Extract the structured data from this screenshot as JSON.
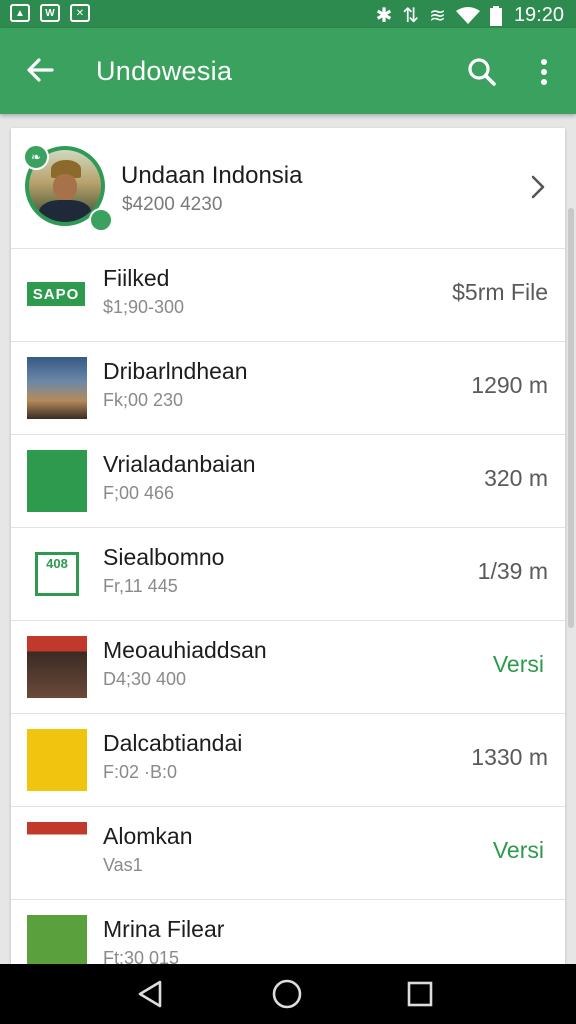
{
  "status_bar": {
    "time": "19:20",
    "left_icons": [
      "image-icon",
      "photo-icon",
      "no-signal-icon"
    ],
    "right_icons": [
      "bluetooth-icon",
      "network-icon",
      "vibrate-icon",
      "wifi-icon",
      "battery-icon"
    ]
  },
  "app_bar": {
    "title": "Undowesia",
    "back_icon": "arrow-left-icon",
    "search_icon": "search-icon",
    "more_icon": "more-vert-icon"
  },
  "profile": {
    "name": "Undaan Indonsia",
    "subtitle": "$4200 4230"
  },
  "rows": [
    {
      "title": "Fiilked",
      "subtitle": "$1;90-300",
      "value": "$5rm File",
      "value_green": false,
      "thumb": "sapo",
      "thumb_label": "SAPO"
    },
    {
      "title": "Dribarlndhean",
      "subtitle": "Fk;00 230",
      "value": "1290 m",
      "value_green": false,
      "thumb": "photo"
    },
    {
      "title": "Vrialadanbaian",
      "subtitle": "F;00 466",
      "value": "320 m",
      "value_green": false,
      "thumb": "green"
    },
    {
      "title": "Siealbomno",
      "subtitle": "Fr,11 445",
      "value": "1/39 m",
      "value_green": false,
      "thumb": "qr",
      "thumb_label": "408"
    },
    {
      "title": "Meoauhiaddsan",
      "subtitle": "D4;30 400",
      "value": "Versi",
      "value_green": true,
      "thumb": "poster"
    },
    {
      "title": "Dalcabtiandai",
      "subtitle": "F:02 ·B:0",
      "value": "1330 m",
      "value_green": false,
      "thumb": "yellow"
    },
    {
      "title": "Alomkan",
      "subtitle": "Vas1",
      "value": "Versi",
      "value_green": true,
      "thumb": "man"
    },
    {
      "title": "Mrina Filear",
      "subtitle": "Ft:30 015",
      "value": "",
      "value_green": false,
      "thumb": "plain"
    }
  ],
  "colors": {
    "status_bar": "#2e8b4f",
    "app_bar": "#3aa25e",
    "accent": "#2e9a4e"
  },
  "nav_bar": {
    "back": "nav-back-icon",
    "home": "nav-home-icon",
    "recents": "nav-recents-icon"
  }
}
